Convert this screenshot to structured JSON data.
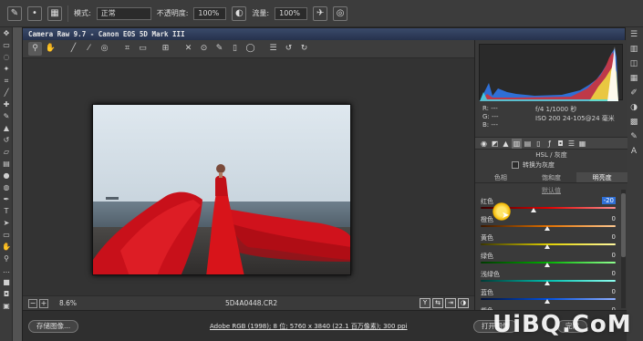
{
  "options_bar": {
    "mode_label": "模式:",
    "mode_value": "正常",
    "opacity_label": "不透明度:",
    "opacity_value": "100%",
    "flow_label": "流量:",
    "flow_value": "100%"
  },
  "dialog": {
    "title": "Camera Raw 9.7 -  Canon EOS 5D Mark III",
    "zoom": "8.6%",
    "filename": "5D4A0448.CR2",
    "save_button": "存储图像...",
    "workflow_options": "Adobe RGB (1998); 8 位; 5760 x 3840 (22.1 百万像素); 300 ppi",
    "open_button": "打开图像",
    "done_button": "完成"
  },
  "camera_info": {
    "r": "R: ---",
    "g": "G: ---",
    "b": "B: ---",
    "line1": "f/4   1/1000 秒",
    "line2": "ISO 200   24-105@24 毫米"
  },
  "panel": {
    "title": "HSL / 灰度",
    "convert_gray": "转换为灰度",
    "tabs": [
      "色相",
      "饱和度",
      "明亮度"
    ],
    "active_tab": 2,
    "default_link": "默认值",
    "sliders": [
      {
        "label": "红色",
        "value": "-20",
        "level": -20,
        "gradient": "linear-gradient(90deg,#3a0000,#e00000,#ff9090)"
      },
      {
        "label": "橙色",
        "value": "0",
        "level": 0,
        "gradient": "linear-gradient(90deg,#3a1800,#e07000,#ffc890)"
      },
      {
        "label": "黄色",
        "value": "0",
        "level": 0,
        "gradient": "linear-gradient(90deg,#3a3600,#e0d000,#fff8a0)"
      },
      {
        "label": "绿色",
        "value": "0",
        "level": 0,
        "gradient": "linear-gradient(90deg,#003a00,#00b000,#90ff90)"
      },
      {
        "label": "浅绿色",
        "value": "0",
        "level": 0,
        "gradient": "linear-gradient(90deg,#003a36,#00c0b0,#90fff0)"
      },
      {
        "label": "蓝色",
        "value": "0",
        "level": 0,
        "gradient": "linear-gradient(90deg,#00103a,#0050e0,#90b0ff)"
      },
      {
        "label": "紫色",
        "value": "0",
        "level": 0,
        "gradient": "linear-gradient(90deg,#20003a,#8000e0,#d0a0ff)"
      }
    ]
  },
  "watermark": "UiBQ.CoM",
  "colors": {
    "accent": "#2f6fd6",
    "red_dress": "#d8141a"
  }
}
